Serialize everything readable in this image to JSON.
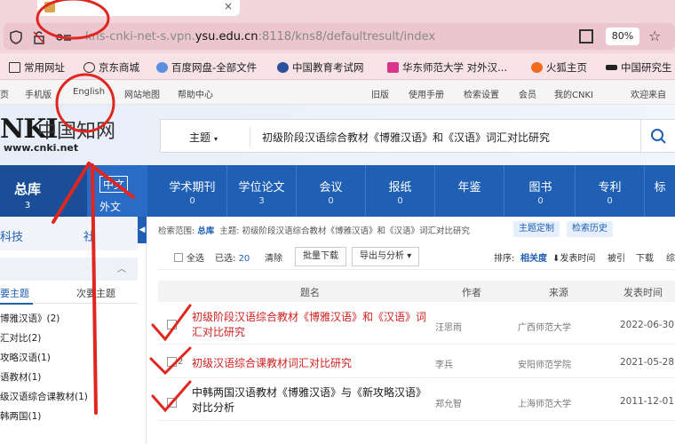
{
  "browser": {
    "tab_close": "×",
    "url_host_prefix": "kns-cnki-net-s.vpn.",
    "url_host": "ysu.edu.cn",
    "url_rest": ":8118/kns8/defaultresult/index",
    "zoom": "80%"
  },
  "bookmarks": [
    {
      "label": "常用网址",
      "color": "#333333"
    },
    {
      "label": "京东商城",
      "color": "#333333"
    },
    {
      "label": "百度网盘-全部文件",
      "color": "#5a8fe0"
    },
    {
      "label": "中国教育考试网",
      "color": "#2a4f9c"
    },
    {
      "label": "华东师范大学 对外汉...",
      "color": "#d8358c"
    },
    {
      "label": "火狐主页",
      "color": "#f26b1d"
    },
    {
      "label": "中国研究生",
      "color": "#222222"
    }
  ],
  "util_nav": [
    "页",
    "手机版",
    "English",
    "网站地图",
    "帮助中心",
    "旧版",
    "使用手册",
    "检索设置",
    "会员",
    "我的CNKI",
    "欢迎来自"
  ],
  "logo": {
    "main": "NKI",
    "cn": "中国知网",
    "url": "www.cnki.net"
  },
  "search": {
    "field": "主题",
    "arrow": "▾",
    "query": "初级阶段汉语综合教材《博雅汉语》和《汉语》词汇对比研究"
  },
  "categories": {
    "all": {
      "name": "总库",
      "count": "3"
    },
    "lang": {
      "zh": "中文",
      "wai": "外文"
    },
    "items": [
      {
        "name": "学术期刊",
        "count": "0"
      },
      {
        "name": "学位论文",
        "count": "3"
      },
      {
        "name": "会议",
        "count": "0"
      },
      {
        "name": "报纸",
        "count": "0"
      },
      {
        "name": "年鉴",
        "count": ""
      },
      {
        "name": "图书",
        "count": "0"
      },
      {
        "name": "专利",
        "count": "0"
      },
      {
        "name": "标",
        "count": ""
      }
    ]
  },
  "sidebar": {
    "tab1": "科技",
    "tab2": "社",
    "collapse": "◀",
    "chevron": "︿",
    "sub1": "要主题",
    "sub2": "次要主题",
    "items": [
      "博雅汉语》(2)",
      "汇对比(2)",
      "攻略汉语(1)",
      "语教材(1)",
      "级汉语综合课教材(1)",
      "韩两国(1)"
    ]
  },
  "results": {
    "scope_label": "检索范围:",
    "scope_lib": "总库",
    "scope_query": "主题: 初级阶段汉语综合教材《博雅汉语》和《汉语》词汇对比研究",
    "btn_custom": "主题定制",
    "btn_history": "检索历史",
    "select_all": "全选",
    "selected_label": "已选:",
    "selected_count": "20",
    "clear": "清除",
    "batch_download": "批量下载",
    "export": "导出与分析",
    "export_arrow": "▾",
    "sort_label": "排序:",
    "sort_active": "相关度",
    "sort_options": [
      "发表时间",
      "被引",
      "下载",
      "综"
    ],
    "col_title": "题名",
    "col_author": "作者",
    "col_source": "来源",
    "col_date": "发表时间",
    "rows": [
      {
        "num": "",
        "title_parts": [
          [
            "初级阶段汉语综合教材《博雅汉语》和《汉语》词",
            true
          ],
          [
            "汇对比研究",
            true
          ]
        ],
        "author": "汪思雨",
        "source": "广西师范大学",
        "date": "2022-06-30"
      },
      {
        "num": "2",
        "title_parts": [
          [
            "初级汉语综合课教材词汇对比研究",
            true
          ]
        ],
        "author": "李兵",
        "source": "安阳师范学院",
        "date": "2021-05-28"
      },
      {
        "num": "",
        "title_parts": [
          [
            "中韩两国汉语教材《博雅汉语》与《新攻略汉语》",
            false
          ],
          [
            "对比分析",
            false
          ]
        ],
        "author": "郑允智",
        "source": "上海师范大学",
        "date": "2011-12-01"
      }
    ]
  }
}
